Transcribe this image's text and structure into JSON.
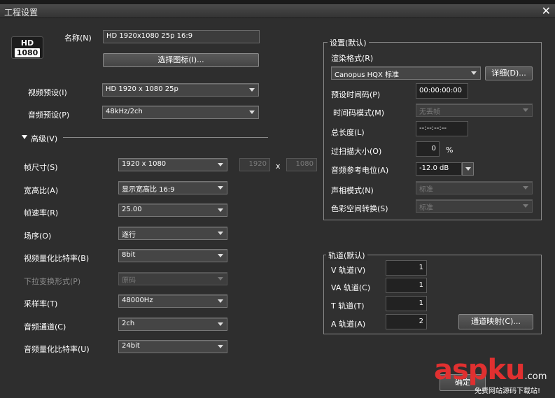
{
  "window": {
    "title": "工程设置",
    "close_glyph": "✕"
  },
  "logo": {
    "line1": "HD",
    "line2": "1080"
  },
  "name_label": "名称(N)",
  "name_value": "HD 1920x1080 25p 16:9",
  "choose_icon_button": "选择图标(I)...",
  "video_preset": {
    "label": "视频预设(I)",
    "value": "HD 1920 x 1080 25p"
  },
  "audio_preset": {
    "label": "音频预设(P)",
    "value": "48kHz/2ch"
  },
  "advanced": {
    "label": "高级(V)"
  },
  "frame_size": {
    "label": "帧尺寸(S)",
    "value": "1920 x 1080",
    "width": "1920",
    "x": "x",
    "height": "1080"
  },
  "aspect": {
    "label": "宽高比(A)",
    "value": "显示宽高比 16:9"
  },
  "frame_rate": {
    "label": "帧速率(R)",
    "value": "25.00"
  },
  "field_order": {
    "label": "场序(O)",
    "value": "逐行"
  },
  "video_bit": {
    "label": "视频量化比特率(B)",
    "value": "8bit"
  },
  "pulldown": {
    "label": "下拉变换形式(P)",
    "value": "原码"
  },
  "sample_rate": {
    "label": "采样率(T)",
    "value": "48000Hz"
  },
  "audio_channels": {
    "label": "音频通道(C)",
    "value": "2ch"
  },
  "audio_bit": {
    "label": "音频量化比特率(U)",
    "value": "24bit"
  },
  "settings_group": {
    "title": "设置(默认)",
    "render_format_label": "渲染格式(R)",
    "render_format_value": "Canopus HQX 标准",
    "details_button": "详细(D)...",
    "preset_timecode_label": "预设时间码(P)",
    "preset_timecode_value": "00:00:00:00",
    "timecode_mode_label": "时间码模式(M)",
    "timecode_mode_value": "无丢帧",
    "total_length_label": "总长度(L)",
    "total_length_value": "--:--:--:--",
    "overscan_label": "过扫描大小(O)",
    "overscan_value": "0",
    "overscan_unit": "%",
    "audio_ref_label": "音频参考电位(A)",
    "audio_ref_value": "-12.0 dB",
    "pan_mode_label": "声相模式(N)",
    "pan_mode_value": "标准",
    "color_space_label": "色彩空间转换(S)",
    "color_space_value": "标准"
  },
  "tracks_group": {
    "title": "轨道(默认)",
    "v_label": "V 轨道(V)",
    "v_value": "1",
    "va_label": "VA 轨道(C)",
    "va_value": "1",
    "t_label": "T 轨道(T)",
    "t_value": "1",
    "a_label": "A 轨道(A)",
    "a_value": "2",
    "channel_map_button": "通道映射(C)..."
  },
  "footer": {
    "ok_button": "确定"
  },
  "watermark": {
    "brand_a": "asp",
    "brand_b": "ku",
    "brand_c": ".com",
    "tagline": "免费网站源码下载站!"
  }
}
